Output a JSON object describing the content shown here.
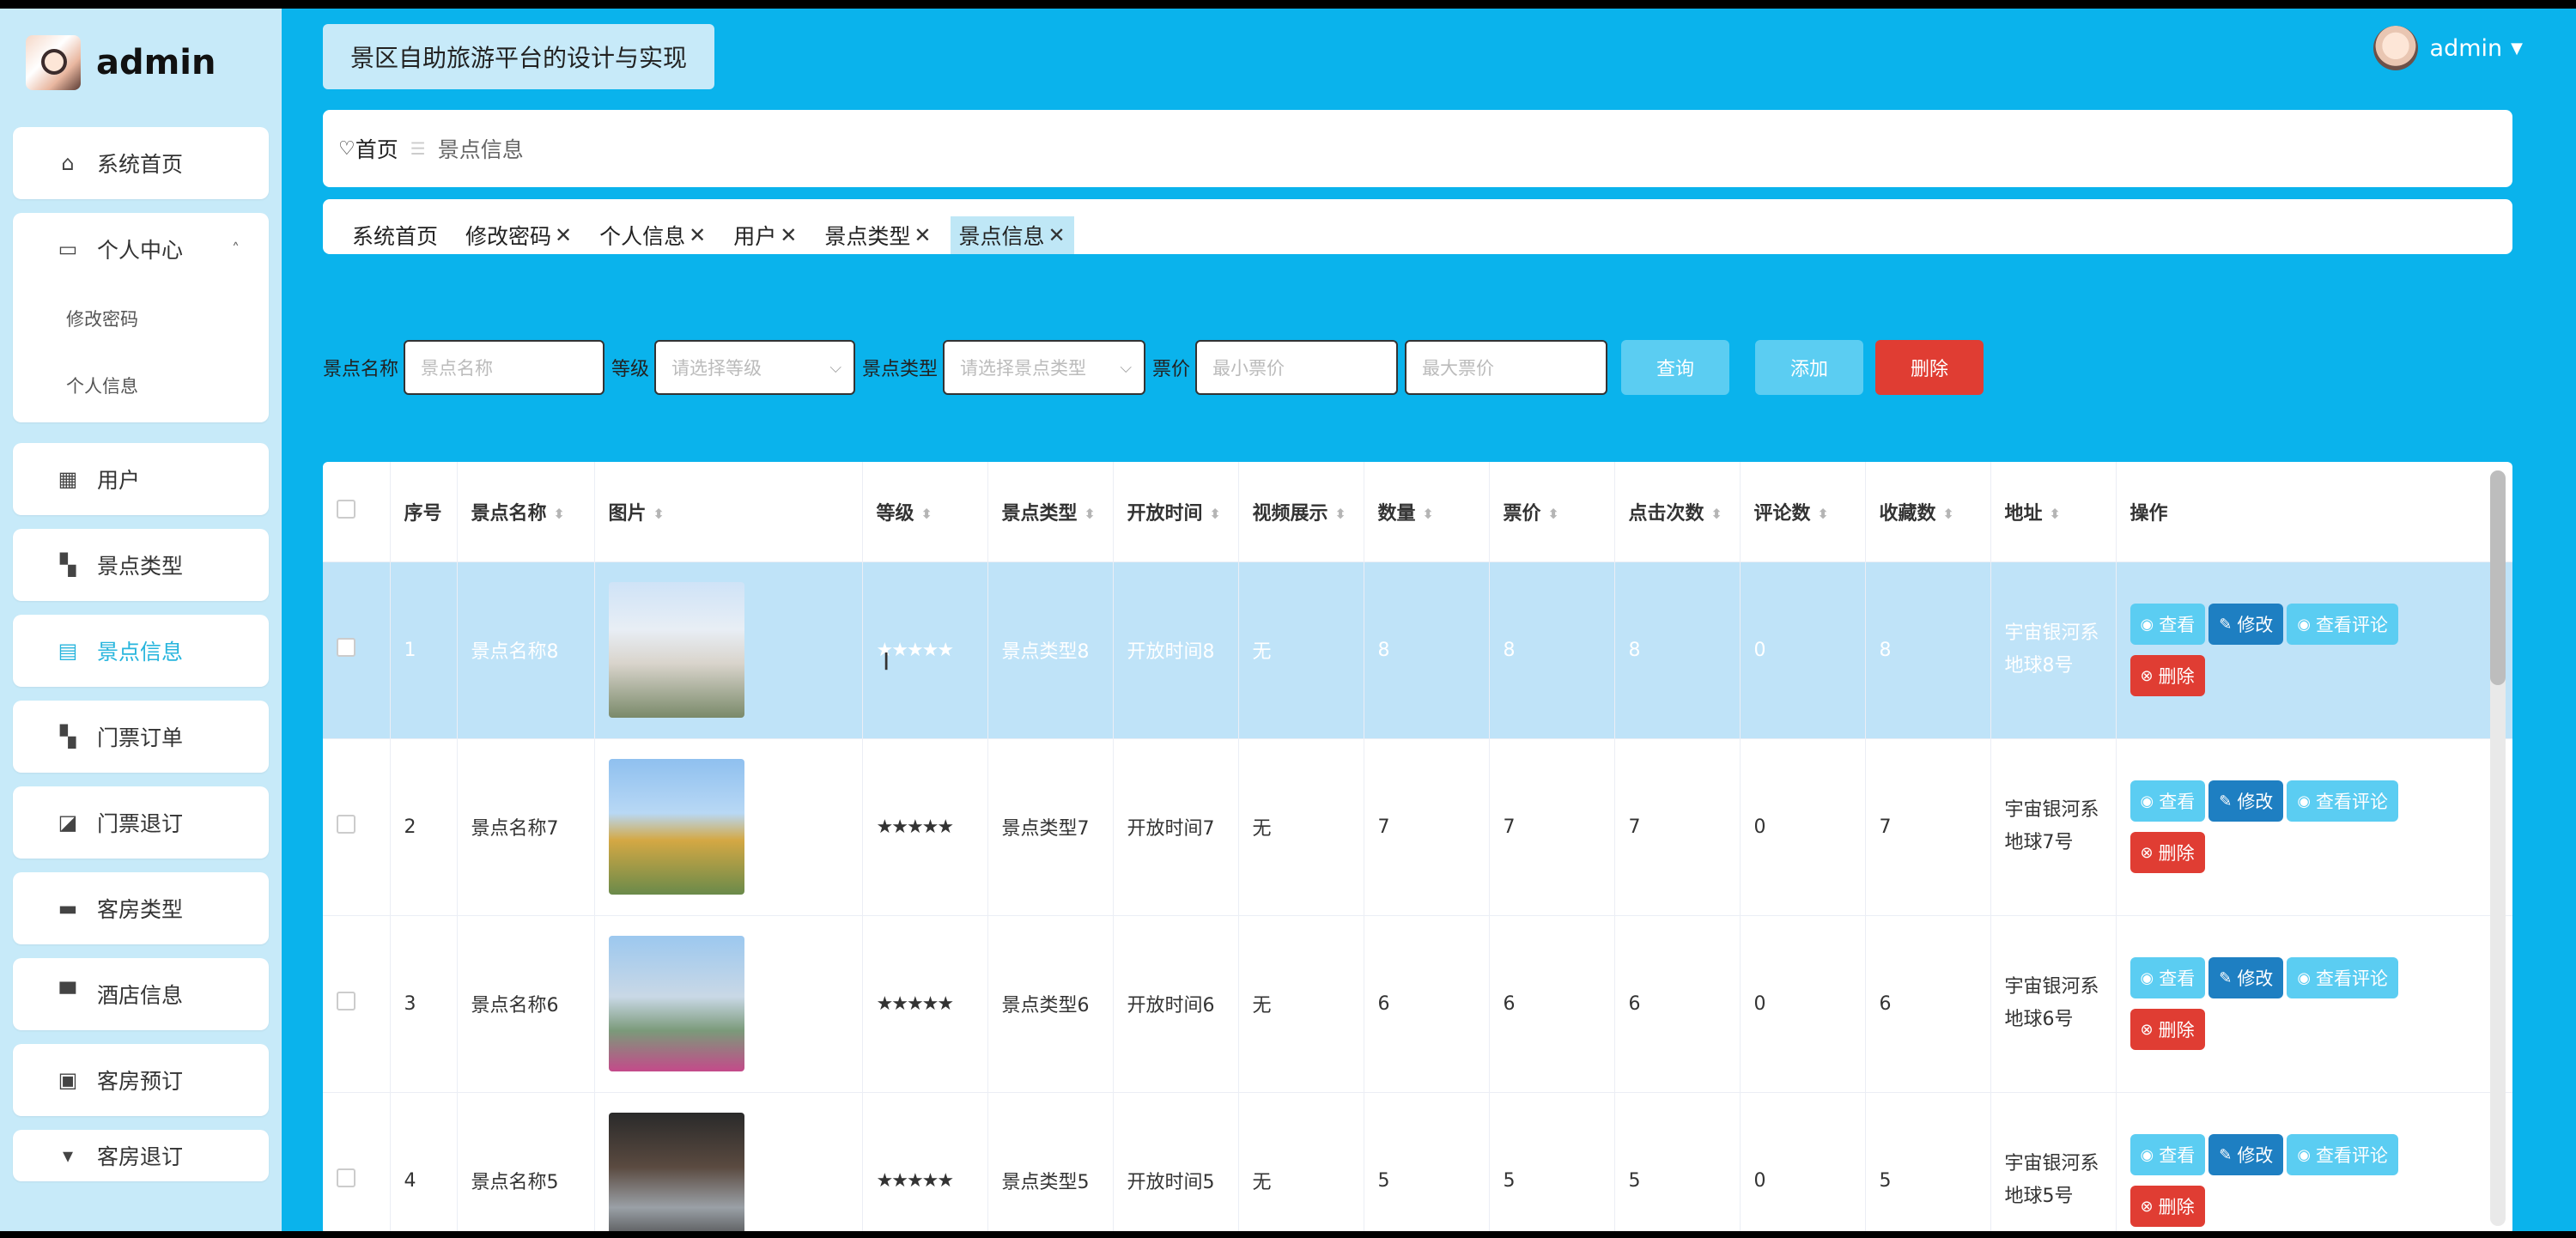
{
  "brand": {
    "name": "admin"
  },
  "header": {
    "title": "景区自助旅游平台的设计与实现",
    "user": "admin"
  },
  "sidebar": {
    "items": [
      {
        "label": "系统首页",
        "icon": "home-icon"
      },
      {
        "label": "个人中心",
        "icon": "card-icon",
        "expanded": true,
        "children": [
          "修改密码",
          "个人信息"
        ]
      },
      {
        "label": "用户",
        "icon": "grid-icon"
      },
      {
        "label": "景点类型",
        "icon": "apps-icon"
      },
      {
        "label": "景点信息",
        "icon": "doc-icon",
        "active": true
      },
      {
        "label": "门票订单",
        "icon": "apps-icon"
      },
      {
        "label": "门票退订",
        "icon": "chart-icon"
      },
      {
        "label": "客房类型",
        "icon": "briefcase-icon"
      },
      {
        "label": "酒店信息",
        "icon": "monitor-icon"
      },
      {
        "label": "客房预订",
        "icon": "clipboard-icon"
      },
      {
        "label": "客房退订",
        "icon": "cup-icon"
      }
    ]
  },
  "breadcrumb": {
    "home": "首页",
    "separator": "☰",
    "current": "景点信息"
  },
  "tags": [
    {
      "label": "系统首页",
      "closable": false
    },
    {
      "label": "修改密码",
      "closable": true
    },
    {
      "label": "个人信息",
      "closable": true
    },
    {
      "label": "用户",
      "closable": true
    },
    {
      "label": "景点类型",
      "closable": true
    },
    {
      "label": "景点信息",
      "closable": true,
      "active": true
    }
  ],
  "search": {
    "name_label": "景点名称",
    "name_placeholder": "景点名称",
    "level_label": "等级",
    "level_placeholder": "请选择等级",
    "type_label": "景点类型",
    "type_placeholder": "请选择景点类型",
    "price_label": "票价",
    "min_placeholder": "最小票价",
    "max_placeholder": "最大票价",
    "query_button": "查询",
    "add_button": "添加",
    "delete_button": "删除"
  },
  "table": {
    "columns": [
      "序号",
      "景点名称",
      "图片",
      "等级",
      "景点类型",
      "开放时间",
      "视频展示",
      "数量",
      "票价",
      "点击次数",
      "评论数",
      "收藏数",
      "地址",
      "操作"
    ],
    "rows": [
      {
        "idx": "1",
        "name": "景点名称8",
        "level": "★★★★★",
        "type": "景点类型8",
        "open": "开放时间8",
        "video": "无",
        "qty": "8",
        "price": "8",
        "clicks": "8",
        "comments": "0",
        "favs": "8",
        "addr": "宇宙银河系地球8号",
        "selected": true
      },
      {
        "idx": "2",
        "name": "景点名称7",
        "level": "★★★★★",
        "type": "景点类型7",
        "open": "开放时间7",
        "video": "无",
        "qty": "7",
        "price": "7",
        "clicks": "7",
        "comments": "0",
        "favs": "7",
        "addr": "宇宙银河系地球7号"
      },
      {
        "idx": "3",
        "name": "景点名称6",
        "level": "★★★★★",
        "type": "景点类型6",
        "open": "开放时间6",
        "video": "无",
        "qty": "6",
        "price": "6",
        "clicks": "6",
        "comments": "0",
        "favs": "6",
        "addr": "宇宙银河系地球6号"
      },
      {
        "idx": "4",
        "name": "景点名称5",
        "level": "★★★★★",
        "type": "景点类型5",
        "open": "开放时间5",
        "video": "无",
        "qty": "5",
        "price": "5",
        "clicks": "5",
        "comments": "0",
        "favs": "5",
        "addr": "宇宙银河系地球5号"
      }
    ],
    "ops": {
      "view": "查看",
      "edit": "修改",
      "comments": "查看评论",
      "delete": "删除"
    }
  },
  "colors": {
    "header_bg": "#0ab3ec",
    "sidebar_bg": "#c7eaf9",
    "active": "#27b5dd",
    "danger": "#e03d33",
    "primary_dark": "#1e7fc2",
    "light_btn": "#5bcdf2"
  }
}
